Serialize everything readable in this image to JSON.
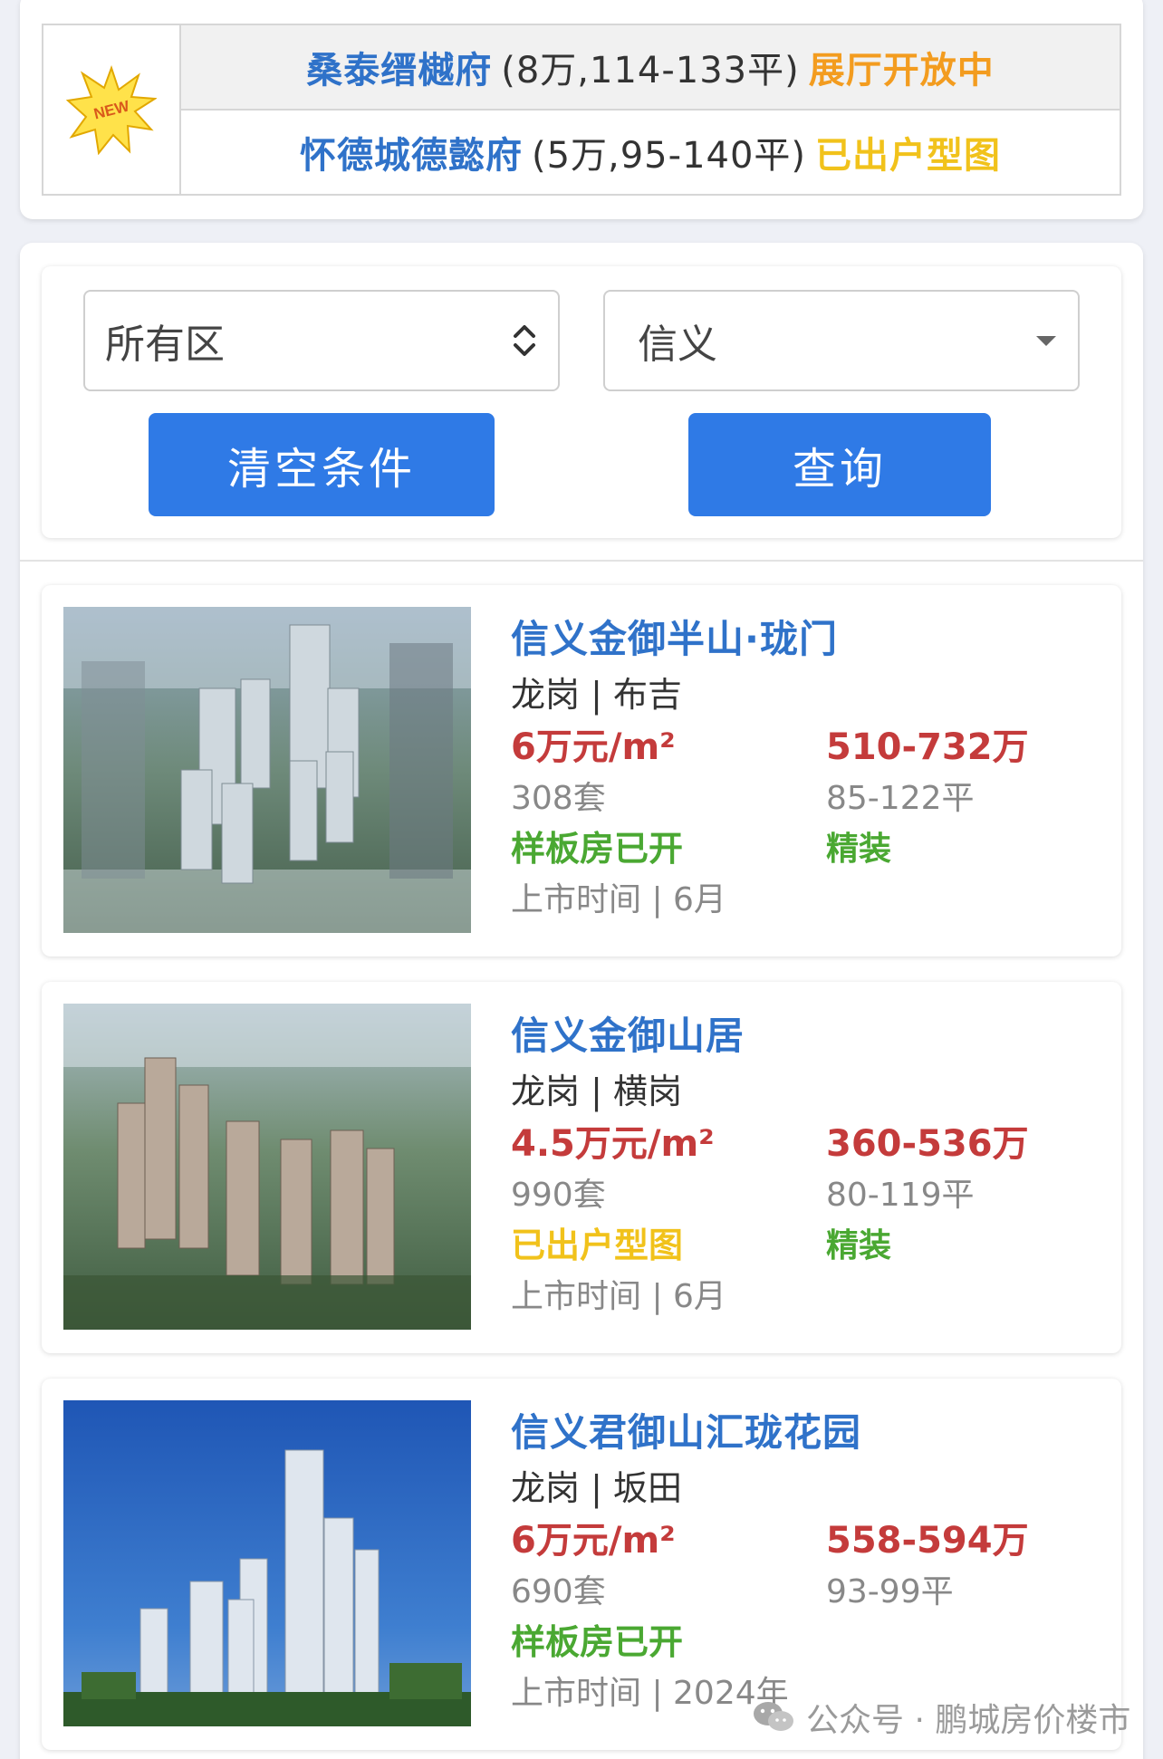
{
  "announcement": {
    "badge_text": "NEW",
    "rows": [
      {
        "name": "桑泰缙樾府",
        "detail": "(8万,114-133平)",
        "status": "展厅开放中"
      },
      {
        "name": "怀德城德懿府",
        "detail": "(5万,95-140平)",
        "status": "已出户型图"
      }
    ]
  },
  "filters": {
    "district": "所有区",
    "developer": "信义",
    "clear_label": "清空条件",
    "query_label": "查询"
  },
  "listings": [
    {
      "name": "信义金御半山·珑门",
      "location": "龙岗 | 布吉",
      "unit_price": "6万元/m²",
      "total_price": "510-732万",
      "units": "308套",
      "area": "85-122平",
      "tag": "样板房已开",
      "decoration": "精装",
      "launch_time": "上市时间 | 6月"
    },
    {
      "name": "信义金御山居",
      "location": "龙岗 | 横岗",
      "unit_price": "4.5万元/m²",
      "total_price": "360-536万",
      "units": "990套",
      "area": "80-119平",
      "tag": "已出户型图",
      "decoration": "精装",
      "launch_time": "上市时间 | 6月"
    },
    {
      "name": "信义君御山汇珑花园",
      "location": "龙岗 | 坂田",
      "unit_price": "6万元/m²",
      "total_price": "558-594万",
      "units": "690套",
      "area": "93-99平",
      "tag": "样板房已开",
      "decoration": "",
      "launch_time": "上市时间 | 2024年"
    }
  ],
  "watermark": "公众号 · 鹏城房价楼市",
  "colors": {
    "name_blue": "#2f72c9",
    "price_red": "#c43b3b",
    "tag_green": "#4aa832",
    "tag_yellow": "#f1c21b",
    "status_orange": "#f39c1f",
    "button_blue": "#2f7ae6"
  },
  "icons": {
    "badge": "new-starburst-icon",
    "district_select": "up-down-chevron-icon",
    "developer_select": "caret-down-icon",
    "watermark": "wechat-icon"
  }
}
